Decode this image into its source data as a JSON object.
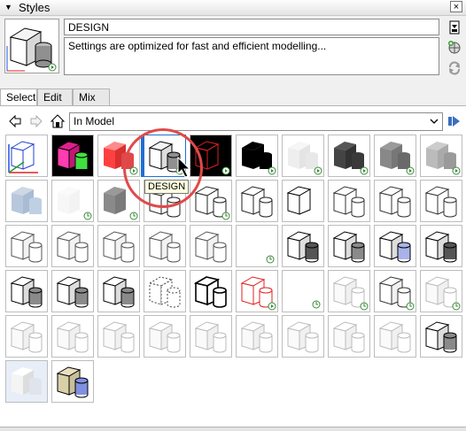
{
  "window": {
    "title": "Styles",
    "collapse_icon": "triangle-down-icon",
    "close_label": "×"
  },
  "style": {
    "name": "DESIGN",
    "description": "Settings are optimized for fast and efficient modelling..."
  },
  "tabs": [
    {
      "label": "Select",
      "active": true
    },
    {
      "label": "Edit",
      "active": false
    },
    {
      "label": "Mix",
      "active": false
    }
  ],
  "nav": {
    "back_icon": "back-arrow-icon",
    "forward_icon": "forward-arrow-icon",
    "home_icon": "home-icon",
    "collection": "In Model",
    "details_icon": "details-arrow-icon"
  },
  "tooltip": "DESIGN",
  "thumbnails": [
    "rgb-outline",
    "magenta-green",
    "red-solid",
    "design-selected",
    "red-wire-black",
    "black-solid",
    "white-soft",
    "dark-solid",
    "gray-solid",
    "light-gray",
    "blue-soft",
    "white-faint",
    "gray-sketch",
    "white-sketch",
    "sketch-cube",
    "sketch-cube-2",
    "blob-outline",
    "sketch-cyl",
    "sketch-box",
    "sketch-box-2",
    "cyl-outline",
    "cyl-outline-2",
    "cyl-outline-3",
    "cyl-faint",
    "cyl-faint-2",
    "empty-green",
    "dark-cyl",
    "gray-cyl",
    "blue-cyl",
    "dark-cyl-2",
    "gray-cyl-3",
    "gray-cyl-4",
    "gray-cyl-5",
    "dashed-cube",
    "black-outline",
    "red-outline",
    "empty-green-2",
    "faint-box",
    "box-outline",
    "faint-cyl",
    "faint-box-2",
    "gray-faint",
    "faint-box-3",
    "faint-box-4",
    "faint-box-5",
    "faint-box-6",
    "faint-box-7",
    "faint-box-8",
    "faint-box-9",
    "gray-cyl-6",
    "photo-soft",
    "tan-blue-cyl"
  ]
}
